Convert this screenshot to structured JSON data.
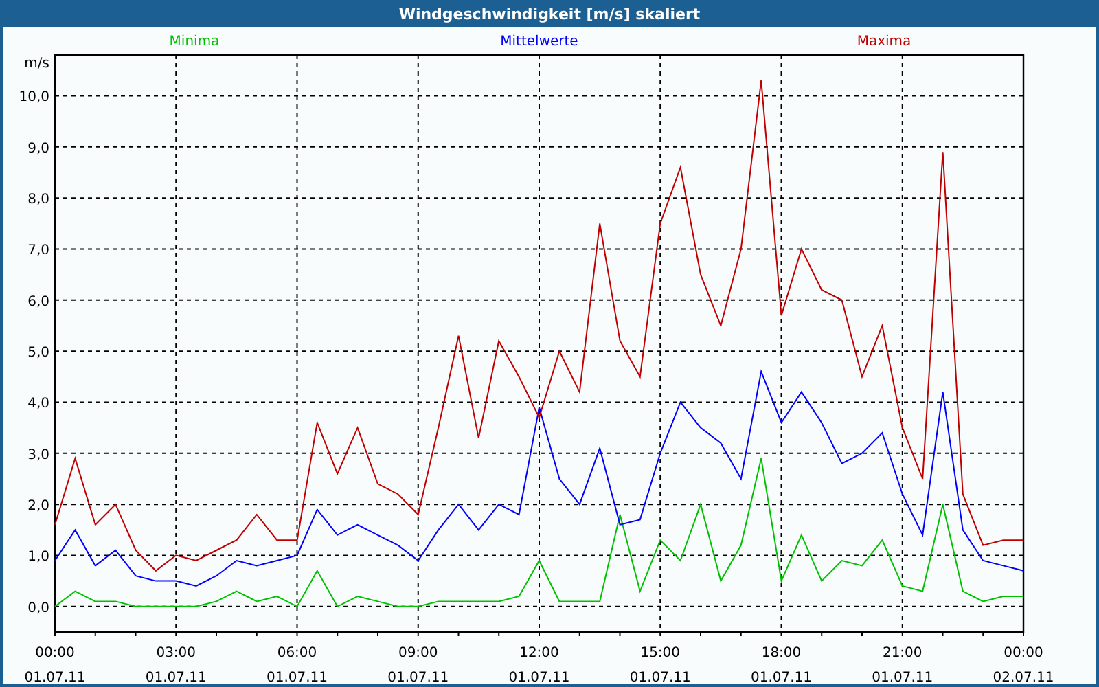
{
  "window": {
    "title": "Windgeschwindigkeit [m/s] skaliert"
  },
  "chart": {
    "chart_data": {
      "type": "line",
      "ylabel": "m/s",
      "categories": [
        "00:00\n01.07.11",
        null,
        null,
        null,
        null,
        null,
        "03:00\n01.07.11",
        null,
        null,
        null,
        null,
        null,
        "06:00\n01.07.11",
        null,
        null,
        null,
        null,
        null,
        "09:00\n01.07.11",
        null,
        null,
        null,
        null,
        null,
        "12:00\n01.07.11",
        null,
        null,
        null,
        null,
        null,
        "15:00\n01.07.11",
        null,
        null,
        null,
        null,
        null,
        "18:00\n01.07.11",
        null,
        null,
        null,
        null,
        null,
        "21:00\n01.07.11",
        null,
        null,
        null,
        null,
        null,
        "00:00\n02.07.11"
      ],
      "series": [
        {
          "name": "Minima",
          "color": "#00c000",
          "values": [
            0,
            0.3,
            0.1,
            0.1,
            0,
            0,
            0,
            0,
            0.1,
            0.3,
            0.1,
            0.2,
            0,
            0.7,
            0,
            0.2,
            0.1,
            0,
            0,
            0.1,
            0.1,
            0.1,
            0.1,
            0.2,
            0.9,
            0.1,
            0.1,
            0.1,
            1.8,
            0.3,
            1.3,
            0.9,
            2.0,
            0.5,
            1.2,
            2.9,
            0.5,
            1.4,
            0.5,
            0.9,
            0.8,
            1.3,
            0.4,
            0.3,
            2.0,
            0.3,
            0.1,
            0.2,
            0.2
          ]
        },
        {
          "name": "Mittelwerte",
          "color": "#0000ff",
          "values": [
            0.9,
            1.5,
            0.8,
            1.1,
            0.6,
            0.5,
            0.5,
            0.4,
            0.6,
            0.9,
            0.8,
            0.9,
            1.0,
            1.9,
            1.4,
            1.6,
            1.4,
            1.2,
            0.9,
            1.5,
            2.0,
            1.5,
            2.0,
            1.8,
            3.9,
            2.5,
            2.0,
            3.1,
            1.6,
            1.7,
            3.0,
            4.0,
            3.5,
            3.2,
            2.5,
            4.6,
            3.6,
            4.2,
            3.6,
            2.8,
            3.0,
            3.4,
            2.2,
            1.4,
            4.2,
            1.5,
            0.9,
            0.8,
            0.7
          ]
        },
        {
          "name": "Maxima",
          "color": "#c00000",
          "values": [
            1.6,
            2.9,
            1.6,
            2.0,
            1.1,
            0.7,
            1.0,
            0.9,
            1.1,
            1.3,
            1.8,
            1.3,
            1.3,
            3.6,
            2.6,
            3.5,
            2.4,
            2.2,
            1.8,
            3.5,
            5.3,
            3.3,
            5.2,
            4.5,
            3.7,
            5.0,
            4.2,
            7.5,
            5.2,
            4.5,
            7.5,
            8.6,
            6.5,
            5.5,
            7.0,
            10.3,
            5.7,
            7.0,
            6.2,
            6.0,
            4.5,
            5.5,
            3.5,
            2.5,
            8.9,
            2.2,
            1.2,
            1.3,
            1.3
          ]
        }
      ],
      "ylim": [
        -0.5,
        10.8
      ],
      "grid": true,
      "yticks": [
        {
          "value": 0,
          "label": "0,0"
        },
        {
          "value": 1,
          "label": "1,0"
        },
        {
          "value": 2,
          "label": "2,0"
        },
        {
          "value": 3,
          "label": "3,0"
        },
        {
          "value": 4,
          "label": "4,0"
        },
        {
          "value": 5,
          "label": "5,0"
        },
        {
          "value": 6,
          "label": "6,0"
        },
        {
          "value": 7,
          "label": "7,0"
        },
        {
          "value": 8,
          "label": "8,0"
        },
        {
          "value": 9,
          "label": "9,0"
        },
        {
          "value": 10,
          "label": "10,0"
        }
      ]
    }
  }
}
